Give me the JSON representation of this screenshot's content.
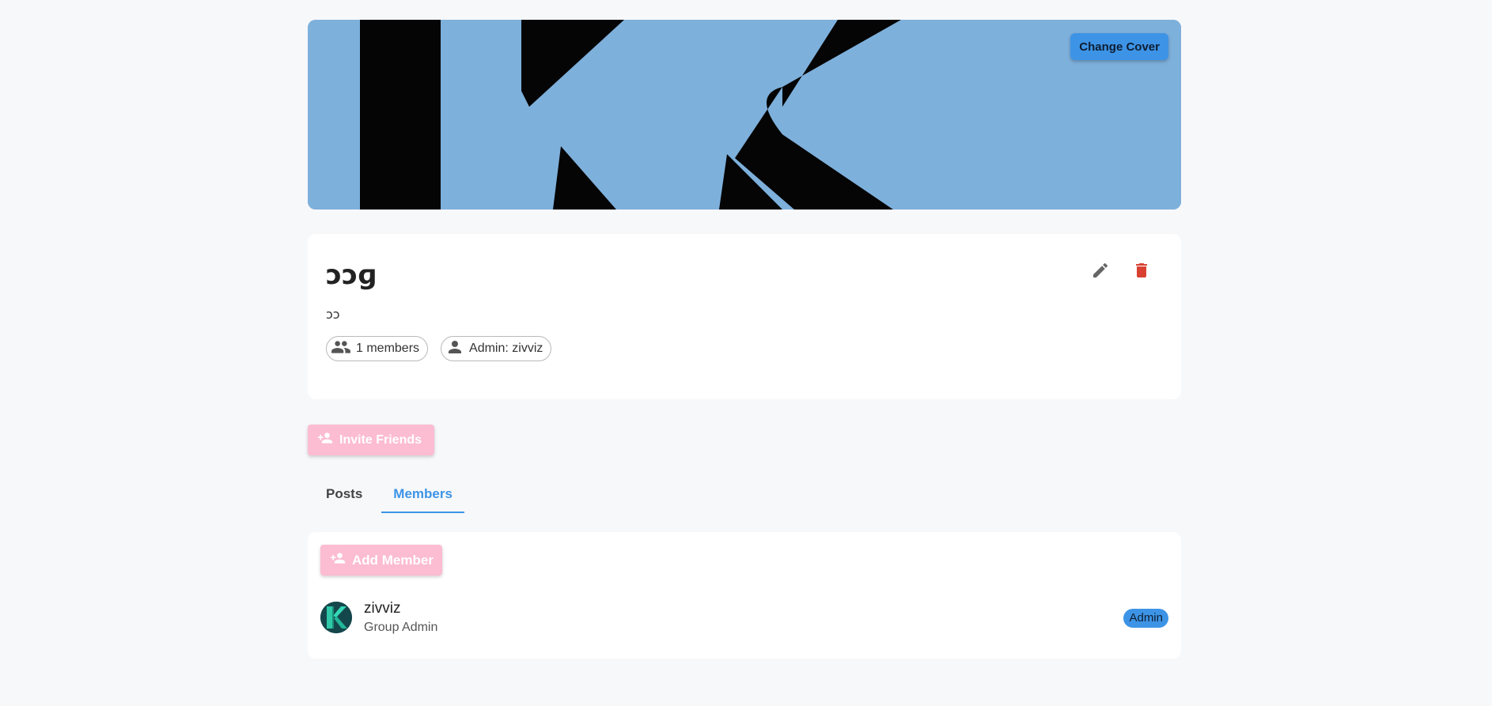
{
  "cover": {
    "change_cover_label": "Change Cover"
  },
  "group": {
    "name": "ɔɔɡ",
    "description": "ɔɔ",
    "members_chip": "1 members",
    "admin_chip": "Admin: zivviz"
  },
  "actions": {
    "invite_label": "Invite Friends"
  },
  "tabs": [
    {
      "label": "Posts"
    },
    {
      "label": "Members"
    }
  ],
  "members_panel": {
    "add_member_label": "Add Member",
    "members": [
      {
        "name": "zivviz",
        "role": "Group Admin",
        "badge": "Admin"
      }
    ]
  },
  "colors": {
    "accent": "#3d94e6",
    "pink_button": "#fcbcd2",
    "delete": "#d84132",
    "cover_bg": "#7eb0dc"
  },
  "icons": {
    "edit": "pencil-icon",
    "delete": "trash-icon",
    "members_chip": "people-icon",
    "admin_chip": "person-icon",
    "invite": "person-add-icon",
    "add_member": "person-add-icon"
  }
}
